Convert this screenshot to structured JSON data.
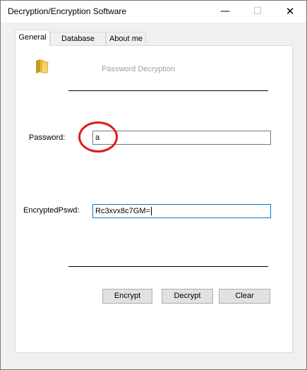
{
  "window": {
    "title": "Decryption/Encryption Software",
    "controls": {
      "minimize": "—",
      "maximize": "☐",
      "close": "✕"
    }
  },
  "tabs": [
    {
      "label": "General",
      "active": true
    },
    {
      "label": "Database",
      "active": false
    },
    {
      "label": "About me",
      "active": false
    }
  ],
  "general": {
    "heading": "Password Decryption",
    "folder_icon": "folder-icon",
    "password": {
      "label": "Password:",
      "value": "a"
    },
    "encrypted": {
      "label": "EncryptedPswd:",
      "value": "Rc3xvx8c7GM="
    },
    "buttons": {
      "encrypt": "Encrypt",
      "decrypt": "Decrypt",
      "clear": "Clear"
    }
  },
  "colors": {
    "annotation": "#e01b1b",
    "focus_border": "#0078d7",
    "heading": "#a0a0a0"
  }
}
